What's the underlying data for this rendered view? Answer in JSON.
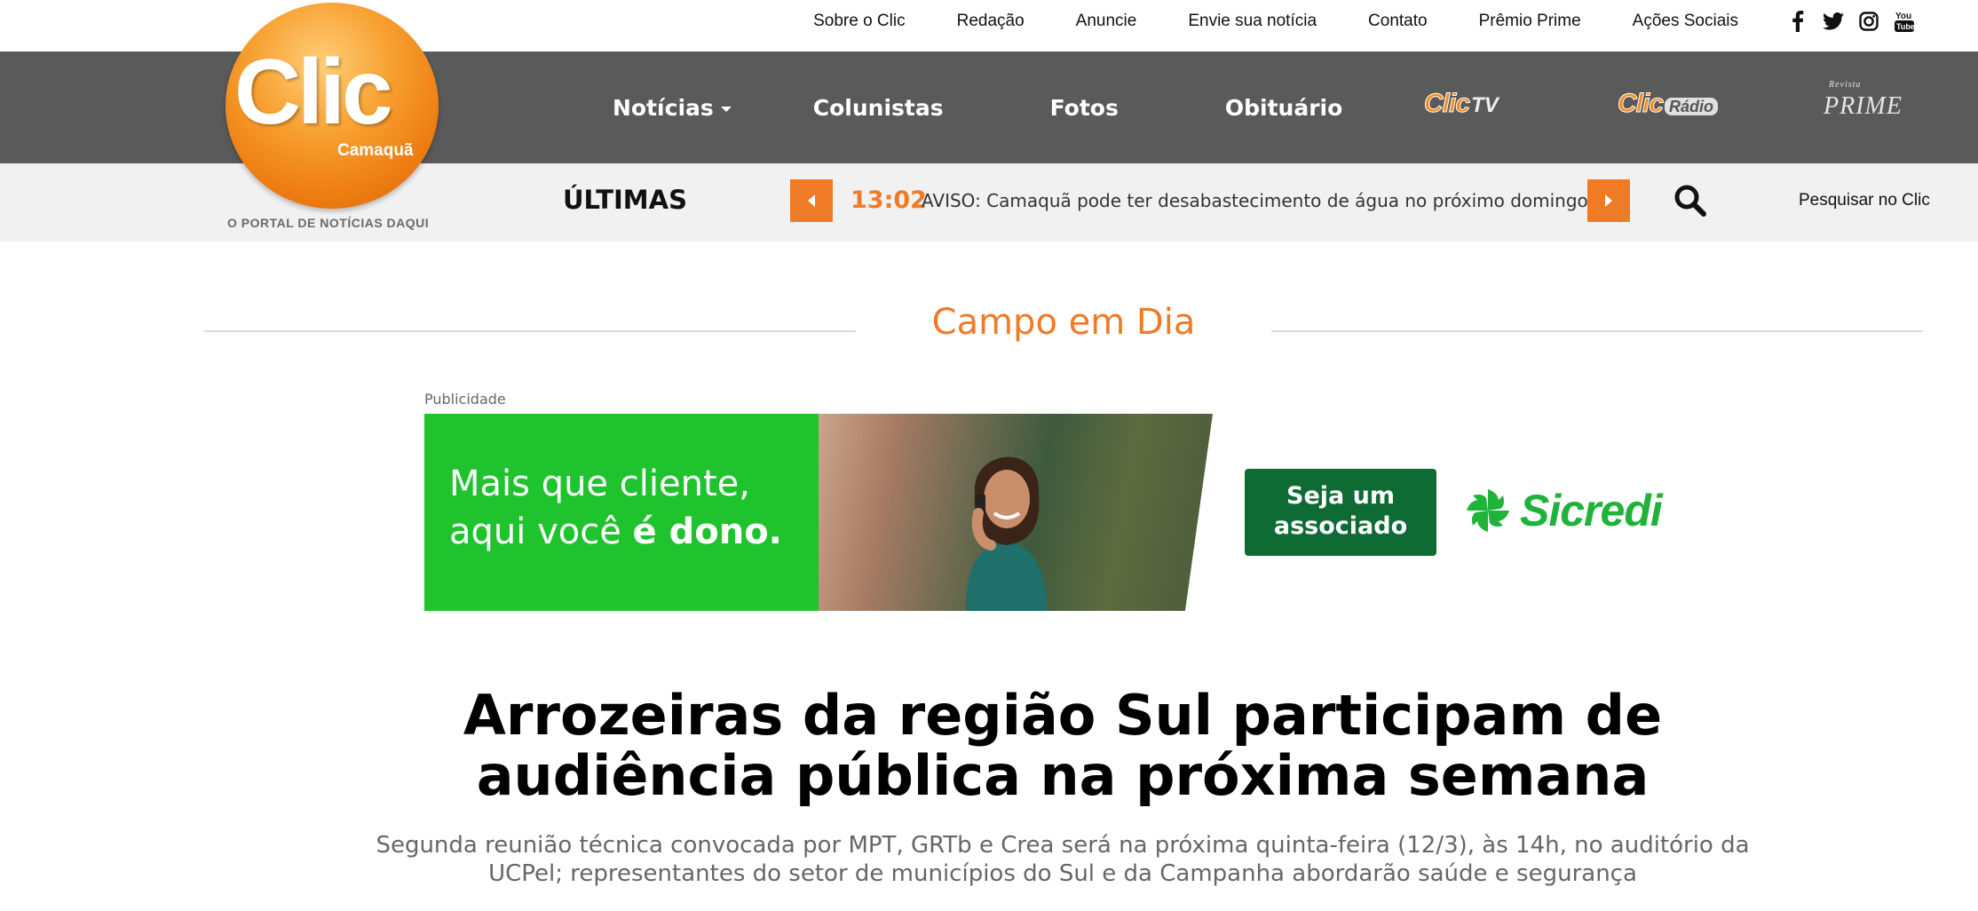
{
  "top_links": [
    "Sobre o Clic",
    "Redação",
    "Anuncie",
    "Envie sua notícia",
    "Contato",
    "Prêmio Prime",
    "Ações Sociais"
  ],
  "socials": [
    "facebook-icon",
    "twitter-icon",
    "instagram-icon",
    "youtube-icon"
  ],
  "logo": {
    "word": "Clic",
    "city": "Camaquã",
    "tagline": "O PORTAL DE NOTÍCIAS DAQUI",
    "color": "#f28a1e"
  },
  "nav": {
    "noticias": "Notícias",
    "colunistas": "Colunistas",
    "fotos": "Fotos",
    "obituario": "Obituário",
    "clictv": {
      "clic": "Clic",
      "suffix": "TV"
    },
    "clicradio": {
      "clic": "Clic",
      "suffix": "Rádio"
    },
    "prime": {
      "small": "Revista",
      "main": "PRIME"
    }
  },
  "ticker": {
    "label": "ÚLTIMAS",
    "time": "13:02",
    "text": "AVISO: Camaquã pode ter desabastecimento de água no próximo domingo",
    "search_label": "Pesquisar no Clic"
  },
  "section": {
    "title": "Campo em Dia"
  },
  "ad": {
    "label": "Publicidade",
    "line1": "Mais que cliente,",
    "line2_prefix": "aqui você ",
    "line2_bold": "é dono.",
    "cta_line1": "Seja um",
    "cta_line2": "associado",
    "brand": "Sicredi"
  },
  "article": {
    "headline": "Arrozeiras da região Sul participam de audiência pública na próxima semana",
    "subtitle": "Segunda reunião técnica convocada por MPT, GRTb e Crea será na próxima quinta-feira (12/3), às 14h, no auditório da UCPel; representantes do setor de municípios do Sul e da Campanha abordarão saúde e segurança"
  },
  "colors": {
    "accent": "#f07b26",
    "nav_bg": "#5a5a5a",
    "ticker_bg": "#f1f1f1",
    "ad_green": "#1fc32e",
    "ad_dark_green": "#0f6b34"
  }
}
